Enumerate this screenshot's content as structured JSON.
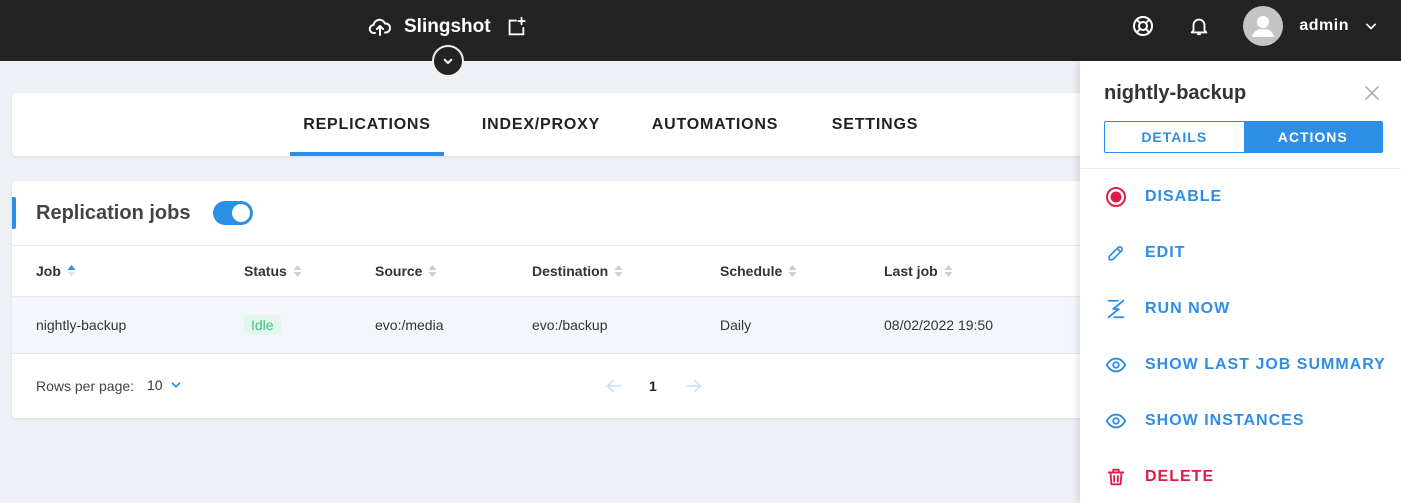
{
  "colors": {
    "accent": "#2d8ee6",
    "danger": "#dc1d4a",
    "topbar": "#232323",
    "success": "#3cc47c"
  },
  "header": {
    "app_name": "Slingshot",
    "user": "admin",
    "icons": [
      "upload-icon",
      "add-window-icon",
      "chevron-down-icon",
      "help-lifebuoy-icon",
      "bell-icon",
      "avatar-icon",
      "chevron-down-icon"
    ]
  },
  "nav": {
    "tabs": [
      {
        "label": "REPLICATIONS",
        "active": true
      },
      {
        "label": "INDEX/PROXY",
        "active": false
      },
      {
        "label": "AUTOMATIONS",
        "active": false
      },
      {
        "label": "SETTINGS",
        "active": false
      }
    ]
  },
  "jobs": {
    "title": "Replication jobs",
    "toggle_on": true,
    "columns": [
      "Job",
      "Status",
      "Source",
      "Destination",
      "Schedule",
      "Last job"
    ],
    "rows": [
      {
        "job": "nightly-backup",
        "status": "Idle",
        "source": "evo:/media",
        "destination": "evo:/backup",
        "schedule": "Daily",
        "last_job": "08/02/2022 19:50"
      }
    ],
    "pagination": {
      "rows_per_page_label": "Rows per page:",
      "rows_per_page": "10",
      "page": "1"
    }
  },
  "panel": {
    "title": "nightly-backup",
    "tabs": [
      {
        "label": "DETAILS",
        "active": false
      },
      {
        "label": "ACTIONS",
        "active": true
      }
    ],
    "actions": [
      {
        "label": "DISABLE",
        "icon": "disable-record-icon"
      },
      {
        "label": "EDIT",
        "icon": "pencil-icon"
      },
      {
        "label": "RUN NOW",
        "icon": "lightning-icon"
      },
      {
        "label": "SHOW LAST JOB SUMMARY",
        "icon": "eye-icon"
      },
      {
        "label": "SHOW INSTANCES",
        "icon": "eye-icon"
      },
      {
        "label": "DELETE",
        "icon": "trash-icon"
      }
    ]
  }
}
